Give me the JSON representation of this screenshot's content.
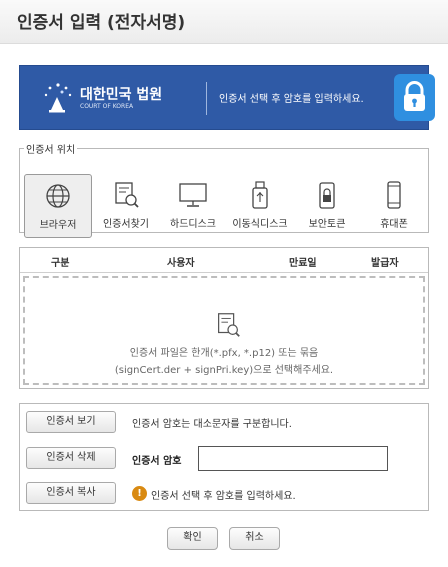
{
  "window": {
    "title": "인증서 입력 (전자서명)"
  },
  "banner": {
    "court_name": "대한민국 법원",
    "court_name_en": "COURT OF KOREA",
    "message": "인증서 선택 후 암호를 입력하세요.",
    "accent_color": "#2f5aa6",
    "lock_color": "#2f8fe0"
  },
  "location": {
    "legend": "인증서 위치",
    "items": [
      {
        "label": "브라우저",
        "icon": "globe-icon",
        "selected": true
      },
      {
        "label": "인증서찾기",
        "icon": "certificate-search-icon",
        "selected": false
      },
      {
        "label": "하드디스크",
        "icon": "monitor-icon",
        "selected": false
      },
      {
        "label": "이동식디스크",
        "icon": "usb-icon",
        "selected": false
      },
      {
        "label": "보안토큰",
        "icon": "security-token-icon",
        "selected": false
      },
      {
        "label": "휴대폰",
        "icon": "mobile-phone-icon",
        "selected": false
      }
    ]
  },
  "cert_list": {
    "columns": [
      "구분",
      "사용자",
      "만료일",
      "발급자"
    ],
    "empty_line1": "인증서 파일은 한개(*.pfx, *.p12) 또는 묶음",
    "empty_line2": "(signCert.der + signPri.key)으로 선택해주세요."
  },
  "actions": {
    "view_button": "인증서 보기",
    "delete_button": "인증서 삭제",
    "copy_button": "인증서 복사",
    "case_note": "인증서 암호는 대소문자를 구분합니다.",
    "password_label": "인증서 암호",
    "password_value": "",
    "warning_text": "인증서 선택 후 암호를 입력하세요.",
    "warning_color": "#d98a12"
  },
  "footer": {
    "ok_button": "확인",
    "cancel_button": "취소"
  }
}
